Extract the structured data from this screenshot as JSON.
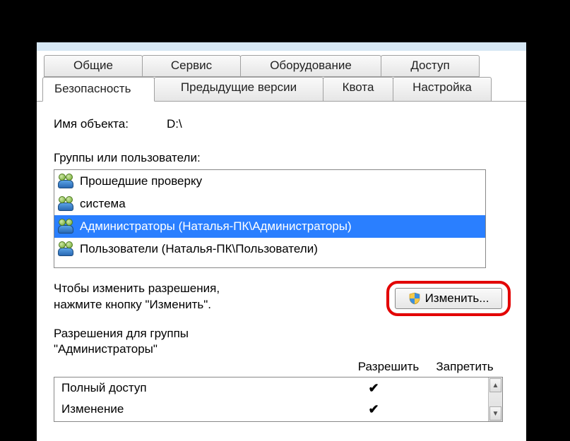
{
  "tabs": {
    "row1": [
      {
        "id": "general",
        "label": "Общие"
      },
      {
        "id": "service",
        "label": "Сервис"
      },
      {
        "id": "hardware",
        "label": "Оборудование"
      },
      {
        "id": "access",
        "label": "Доступ"
      }
    ],
    "row2": [
      {
        "id": "security",
        "label": "Безопасность",
        "active": true
      },
      {
        "id": "prev",
        "label": "Предыдущие версии"
      },
      {
        "id": "quota",
        "label": "Квота"
      },
      {
        "id": "settings",
        "label": "Настройка"
      }
    ]
  },
  "object": {
    "label": "Имя объекта:",
    "value": "D:\\"
  },
  "groups": {
    "label": "Группы или пользователи:",
    "items": [
      {
        "text": "Прошедшие проверку",
        "selected": false
      },
      {
        "text": "система",
        "selected": false
      },
      {
        "text": "Администраторы (Наталья-ПК\\Администраторы)",
        "selected": true
      },
      {
        "text": "Пользователи (Наталья-ПК\\Пользователи)",
        "selected": false
      }
    ]
  },
  "hint": {
    "line1": "Чтобы изменить разрешения,",
    "line2": "нажмите кнопку \"Изменить\"."
  },
  "change_button": {
    "label": "Изменить..."
  },
  "permissions": {
    "title_line1": "Разрешения для группы",
    "title_line2": "\"Администраторы\"",
    "col_allow": "Разрешить",
    "col_deny": "Запретить",
    "rows": [
      {
        "name": "Полный доступ",
        "allow": "✔",
        "deny": ""
      },
      {
        "name": "Изменение",
        "allow": "✔",
        "deny": ""
      }
    ]
  }
}
